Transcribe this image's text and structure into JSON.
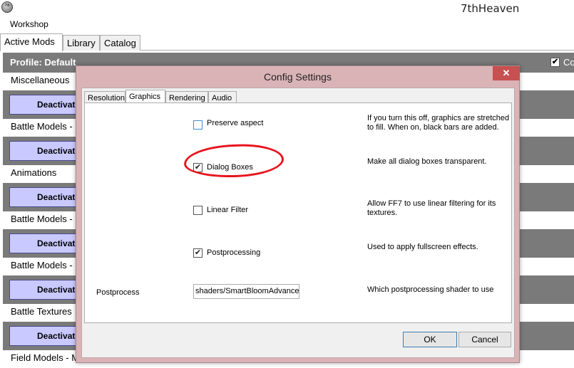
{
  "window": {
    "icon_text": "7th",
    "title": "7thHeaven"
  },
  "menu": {
    "items": [
      "Workshop"
    ]
  },
  "main_tabs": [
    "Active Mods",
    "Library",
    "Catalog"
  ],
  "profile": {
    "label": "Profile: Default",
    "checkbox_text": "Co",
    "checked_glyph": "✔"
  },
  "mods": {
    "deactivate_label": "Deactivate",
    "categories": [
      "Miscellaneous",
      "Battle Models -",
      "Animations",
      "Battle Models -",
      "Battle Models -",
      "Battle Textures",
      "Field Models - M"
    ]
  },
  "dialog": {
    "title": "Config Settings",
    "close_glyph": "✕",
    "tabs": [
      "Resolution",
      "Graphics",
      "Rendering",
      "Audio"
    ],
    "active_tab": "Graphics",
    "options": [
      {
        "label": "Preserve aspect",
        "checked": false,
        "description": "If you turn this off, graphics are stretched to fill. When on, black bars are added."
      },
      {
        "label": "Dialog Boxes",
        "checked": true,
        "check_glyph": "✔",
        "description": "Make all dialog boxes transparent."
      },
      {
        "label": "Linear Filter",
        "checked": false,
        "description": "Allow FF7 to use linear filtering for its textures."
      },
      {
        "label": "Postprocessing",
        "checked": true,
        "check_glyph": "✔",
        "description": "Used to apply fullscreen effects."
      }
    ],
    "postprocess": {
      "label": "Postprocess",
      "value": "shaders/SmartBloomAdvanced",
      "description": "Which postprocessing shader to use"
    },
    "ok_label": "OK",
    "cancel_label": "Cancel"
  },
  "colors": {
    "dialog_frame": "#dab3b6",
    "close_button": "#c75050",
    "deactivate_button": "#c9c9ff",
    "mod_row": "#7a7a7a",
    "annotation": "#e8141d"
  }
}
